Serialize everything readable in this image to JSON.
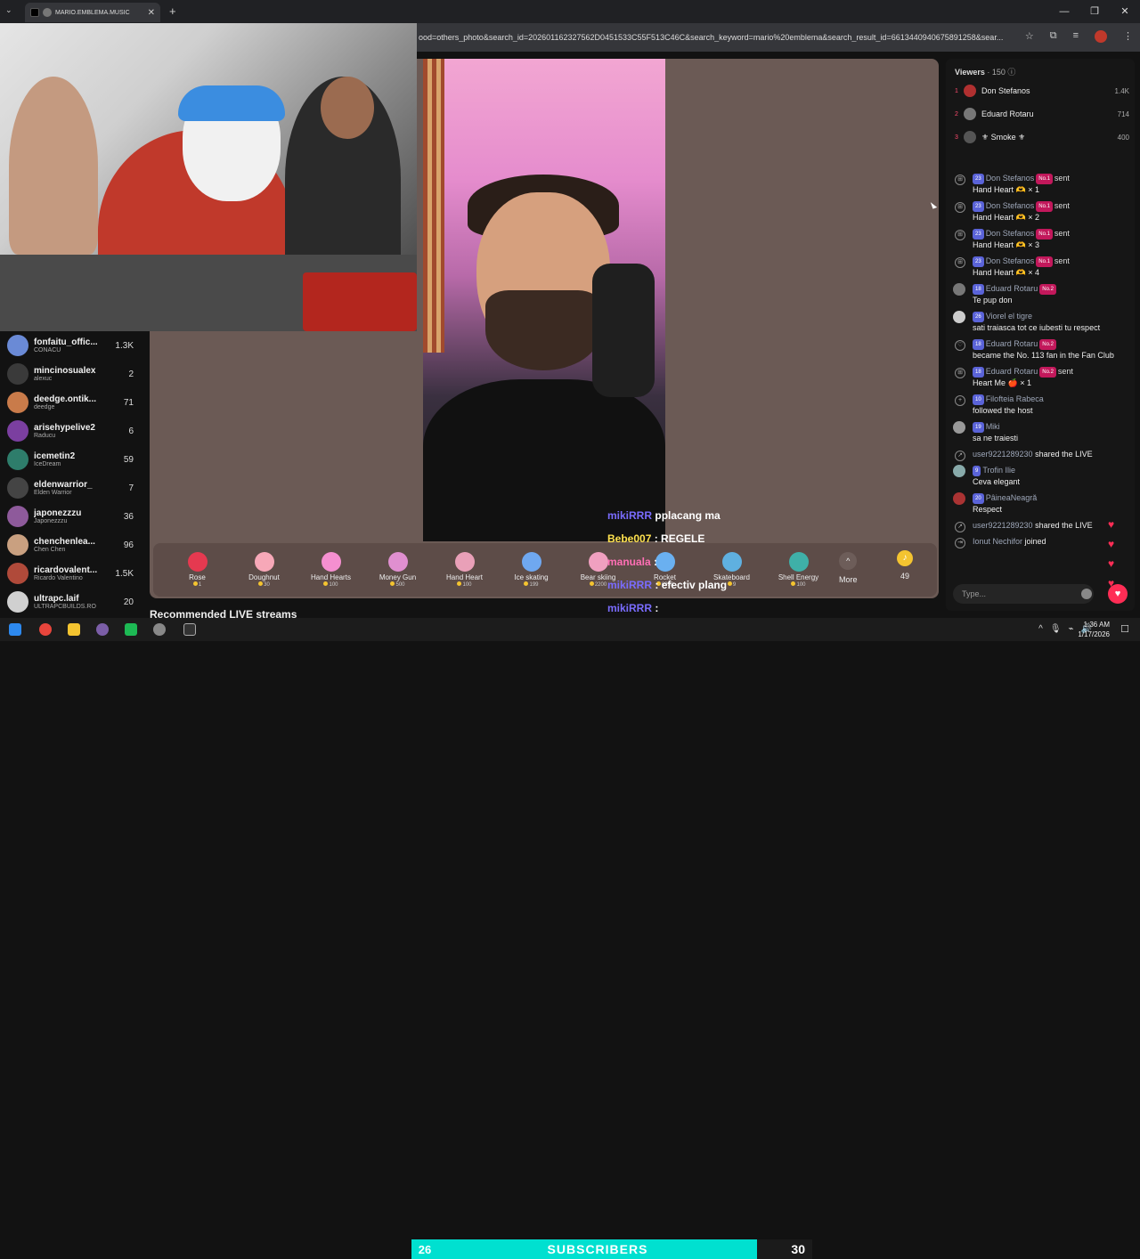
{
  "browser": {
    "tab_title": "MARIO.EMBLEMA.MUSIC",
    "url": "ood=others_photo&search_id=202601162327562D0451533C55F513C46C&search_keyword=mario%20emblema&search_result_id=6613440940675891258&sear..."
  },
  "sidebar": {
    "items": [
      {
        "name": "fonfaitu_offic...",
        "sub": "CONACU",
        "count": "1.3K",
        "color": "#6a8ad6"
      },
      {
        "name": "mincinosualex",
        "sub": "alexuc",
        "count": "2",
        "color": "#3a3a3a"
      },
      {
        "name": "deedge.ontik...",
        "sub": "deedge",
        "count": "71",
        "color": "#c97b4a"
      },
      {
        "name": "arisehypelive2",
        "sub": "Raducu",
        "count": "6",
        "color": "#7b3fa0"
      },
      {
        "name": "icemetin2",
        "sub": "IceDream",
        "count": "59",
        "color": "#2e7d6b"
      },
      {
        "name": "eldenwarrior_",
        "sub": "Elden Warrior",
        "count": "7",
        "color": "#444"
      },
      {
        "name": "japonezzzu",
        "sub": "Japonezzzu",
        "count": "36",
        "color": "#8e5a9b"
      },
      {
        "name": "chenchenlea...",
        "sub": "Chen Chen",
        "count": "96",
        "color": "#c9a080"
      },
      {
        "name": "ricardovalent...",
        "sub": "Ricardo Valentino",
        "count": "1.5K",
        "color": "#b04a3a"
      },
      {
        "name": "ultrapc.laif",
        "sub": "ULTRAPCBUILDS.RO",
        "count": "20",
        "color": "#d0d0d0"
      }
    ]
  },
  "gifts": [
    {
      "name": "Rose",
      "price": "1",
      "color": "#e53950"
    },
    {
      "name": "Doughnut",
      "price": "30",
      "color": "#f7a8b8"
    },
    {
      "name": "Hand Hearts",
      "price": "100",
      "color": "#f58fd0"
    },
    {
      "name": "Money Gun",
      "price": "500",
      "color": "#e08fd0"
    },
    {
      "name": "Hand Heart",
      "price": "100",
      "color": "#e9a0b8"
    },
    {
      "name": "Ice skating",
      "price": "199",
      "color": "#6fa8f0"
    },
    {
      "name": "Bear skiing",
      "price": "2200",
      "color": "#f0a0c0"
    },
    {
      "name": "Rocket",
      "price": "6999",
      "color": "#6ab0f0"
    },
    {
      "name": "Skateboard",
      "price": "9",
      "color": "#5fb0e0"
    },
    {
      "name": "Shell Energy",
      "price": "100",
      "color": "#3fb0a8"
    }
  ],
  "gift_more": "More",
  "coin_balance": "49",
  "overlay_chat": [
    {
      "user": "mikiRRR",
      "msg": "pplacang ma",
      "cls": "u1"
    },
    {
      "user": "Bebe007",
      "msg": ": REGELE",
      "cls": "u2"
    },
    {
      "user": "manuala",
      "msg": ":",
      "cls": "u3"
    },
    {
      "user": "mikiRRR",
      "msg": ": efectiv plang",
      "cls": "u1"
    },
    {
      "user": "mikiRRR",
      "msg": ":",
      "cls": "u1"
    }
  ],
  "recommended": "Recommended LIVE streams",
  "subscribers": {
    "left": "26",
    "label": "SUBSCRIBERS",
    "right": "30"
  },
  "viewers": {
    "title": "Viewers",
    "count": "· 150",
    "top": [
      {
        "rank": "1",
        "name": "Don Stefanos",
        "score": "1.4K",
        "color": "#b03030"
      },
      {
        "rank": "2",
        "name": "Eduard Rotaru",
        "score": "714",
        "color": "#777"
      },
      {
        "rank": "3",
        "name": "⚜ Smoke ⚜",
        "score": "400",
        "color": "#555"
      }
    ]
  },
  "feed": [
    {
      "type": "gift",
      "lvl": "23",
      "user": "Don Stefanos",
      "badge": "No.1",
      "text": "Hand Heart 🫶 × 1"
    },
    {
      "type": "gift",
      "lvl": "23",
      "user": "Don Stefanos",
      "badge": "No.1",
      "text": "Hand Heart 🫶 × 2"
    },
    {
      "type": "gift",
      "lvl": "23",
      "user": "Don Stefanos",
      "badge": "No.1",
      "text": "Hand Heart 🫶 × 3"
    },
    {
      "type": "gift",
      "lvl": "23",
      "user": "Don Stefanos",
      "badge": "No.1",
      "text": "Hand Heart 🫶 × 4"
    },
    {
      "type": "chat",
      "lvl": "18",
      "user": "Eduard Rotaru",
      "badge": "No.2",
      "text": "Te pup don"
    },
    {
      "type": "chat",
      "lvl": "26",
      "user": "Viorel el tigre",
      "badge": "",
      "text": "sati traiasca tot ce iubesti tu respect"
    },
    {
      "type": "fan",
      "lvl": "18",
      "user": "Eduard Rotaru",
      "badge": "No.2",
      "text": "became the No. 113 fan in the Fan Club"
    },
    {
      "type": "gift",
      "lvl": "18",
      "user": "Eduard Rotaru",
      "badge": "No.2",
      "text": "Heart Me 🍎 × 1"
    },
    {
      "type": "follow",
      "lvl": "10",
      "user": "Filofteia Rabeca",
      "badge": "",
      "text": "followed the host"
    },
    {
      "type": "chat",
      "lvl": "19",
      "user": "Miki",
      "badge": "",
      "text": "sa ne traiesti"
    },
    {
      "type": "share",
      "lvl": "",
      "user": "user9221289230",
      "badge": "",
      "text": "shared the LIVE"
    },
    {
      "type": "chat",
      "lvl": "9",
      "user": "Trofin Ilie",
      "badge": "",
      "text": "Ceva elegant"
    },
    {
      "type": "chat",
      "lvl": "20",
      "user": "PâineaNeagră",
      "badge": "",
      "text": "Respect"
    },
    {
      "type": "share",
      "lvl": "",
      "user": "user9221289230",
      "badge": "",
      "text": "shared the LIVE"
    },
    {
      "type": "join",
      "lvl": "",
      "user": "Ionut Nechifor",
      "badge": "",
      "text": "joined"
    }
  ],
  "sent_word": "sent",
  "type_placeholder": "Type...",
  "clock": {
    "time": "1:36 AM",
    "date": "1/17/2026"
  }
}
